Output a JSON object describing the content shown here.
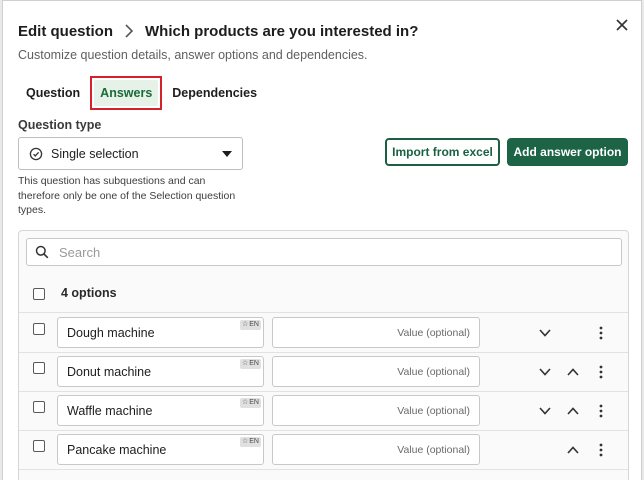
{
  "header": {
    "breadcrumb": "Edit question",
    "title": "Which products are you interested in?",
    "subtitle": "Customize question details, answer options and dependencies."
  },
  "tabs": [
    {
      "label": "Question",
      "active": false
    },
    {
      "label": "Answers",
      "active": true
    },
    {
      "label": "Dependencies",
      "active": false
    }
  ],
  "question_type": {
    "label": "Question type",
    "value": "Single selection",
    "help": "This question has subquestions and can therefore only be one of the Selection question types."
  },
  "buttons": {
    "import": "Import from excel",
    "add": "Add answer option"
  },
  "search": {
    "placeholder": "Search"
  },
  "options": {
    "count_label": "4 options",
    "value_placeholder": "Value (optional)",
    "lang_badge": "EN",
    "items": [
      {
        "name": "Dough machine",
        "down": true,
        "up": false
      },
      {
        "name": "Donut machine",
        "down": true,
        "up": true
      },
      {
        "name": "Waffle machine",
        "down": true,
        "up": true
      },
      {
        "name": "Pancake machine",
        "down": false,
        "up": true
      }
    ]
  },
  "colors": {
    "primary": "#1d6447",
    "active_tab_bg": "#e6f1e8",
    "highlight_border": "#d4222a"
  }
}
